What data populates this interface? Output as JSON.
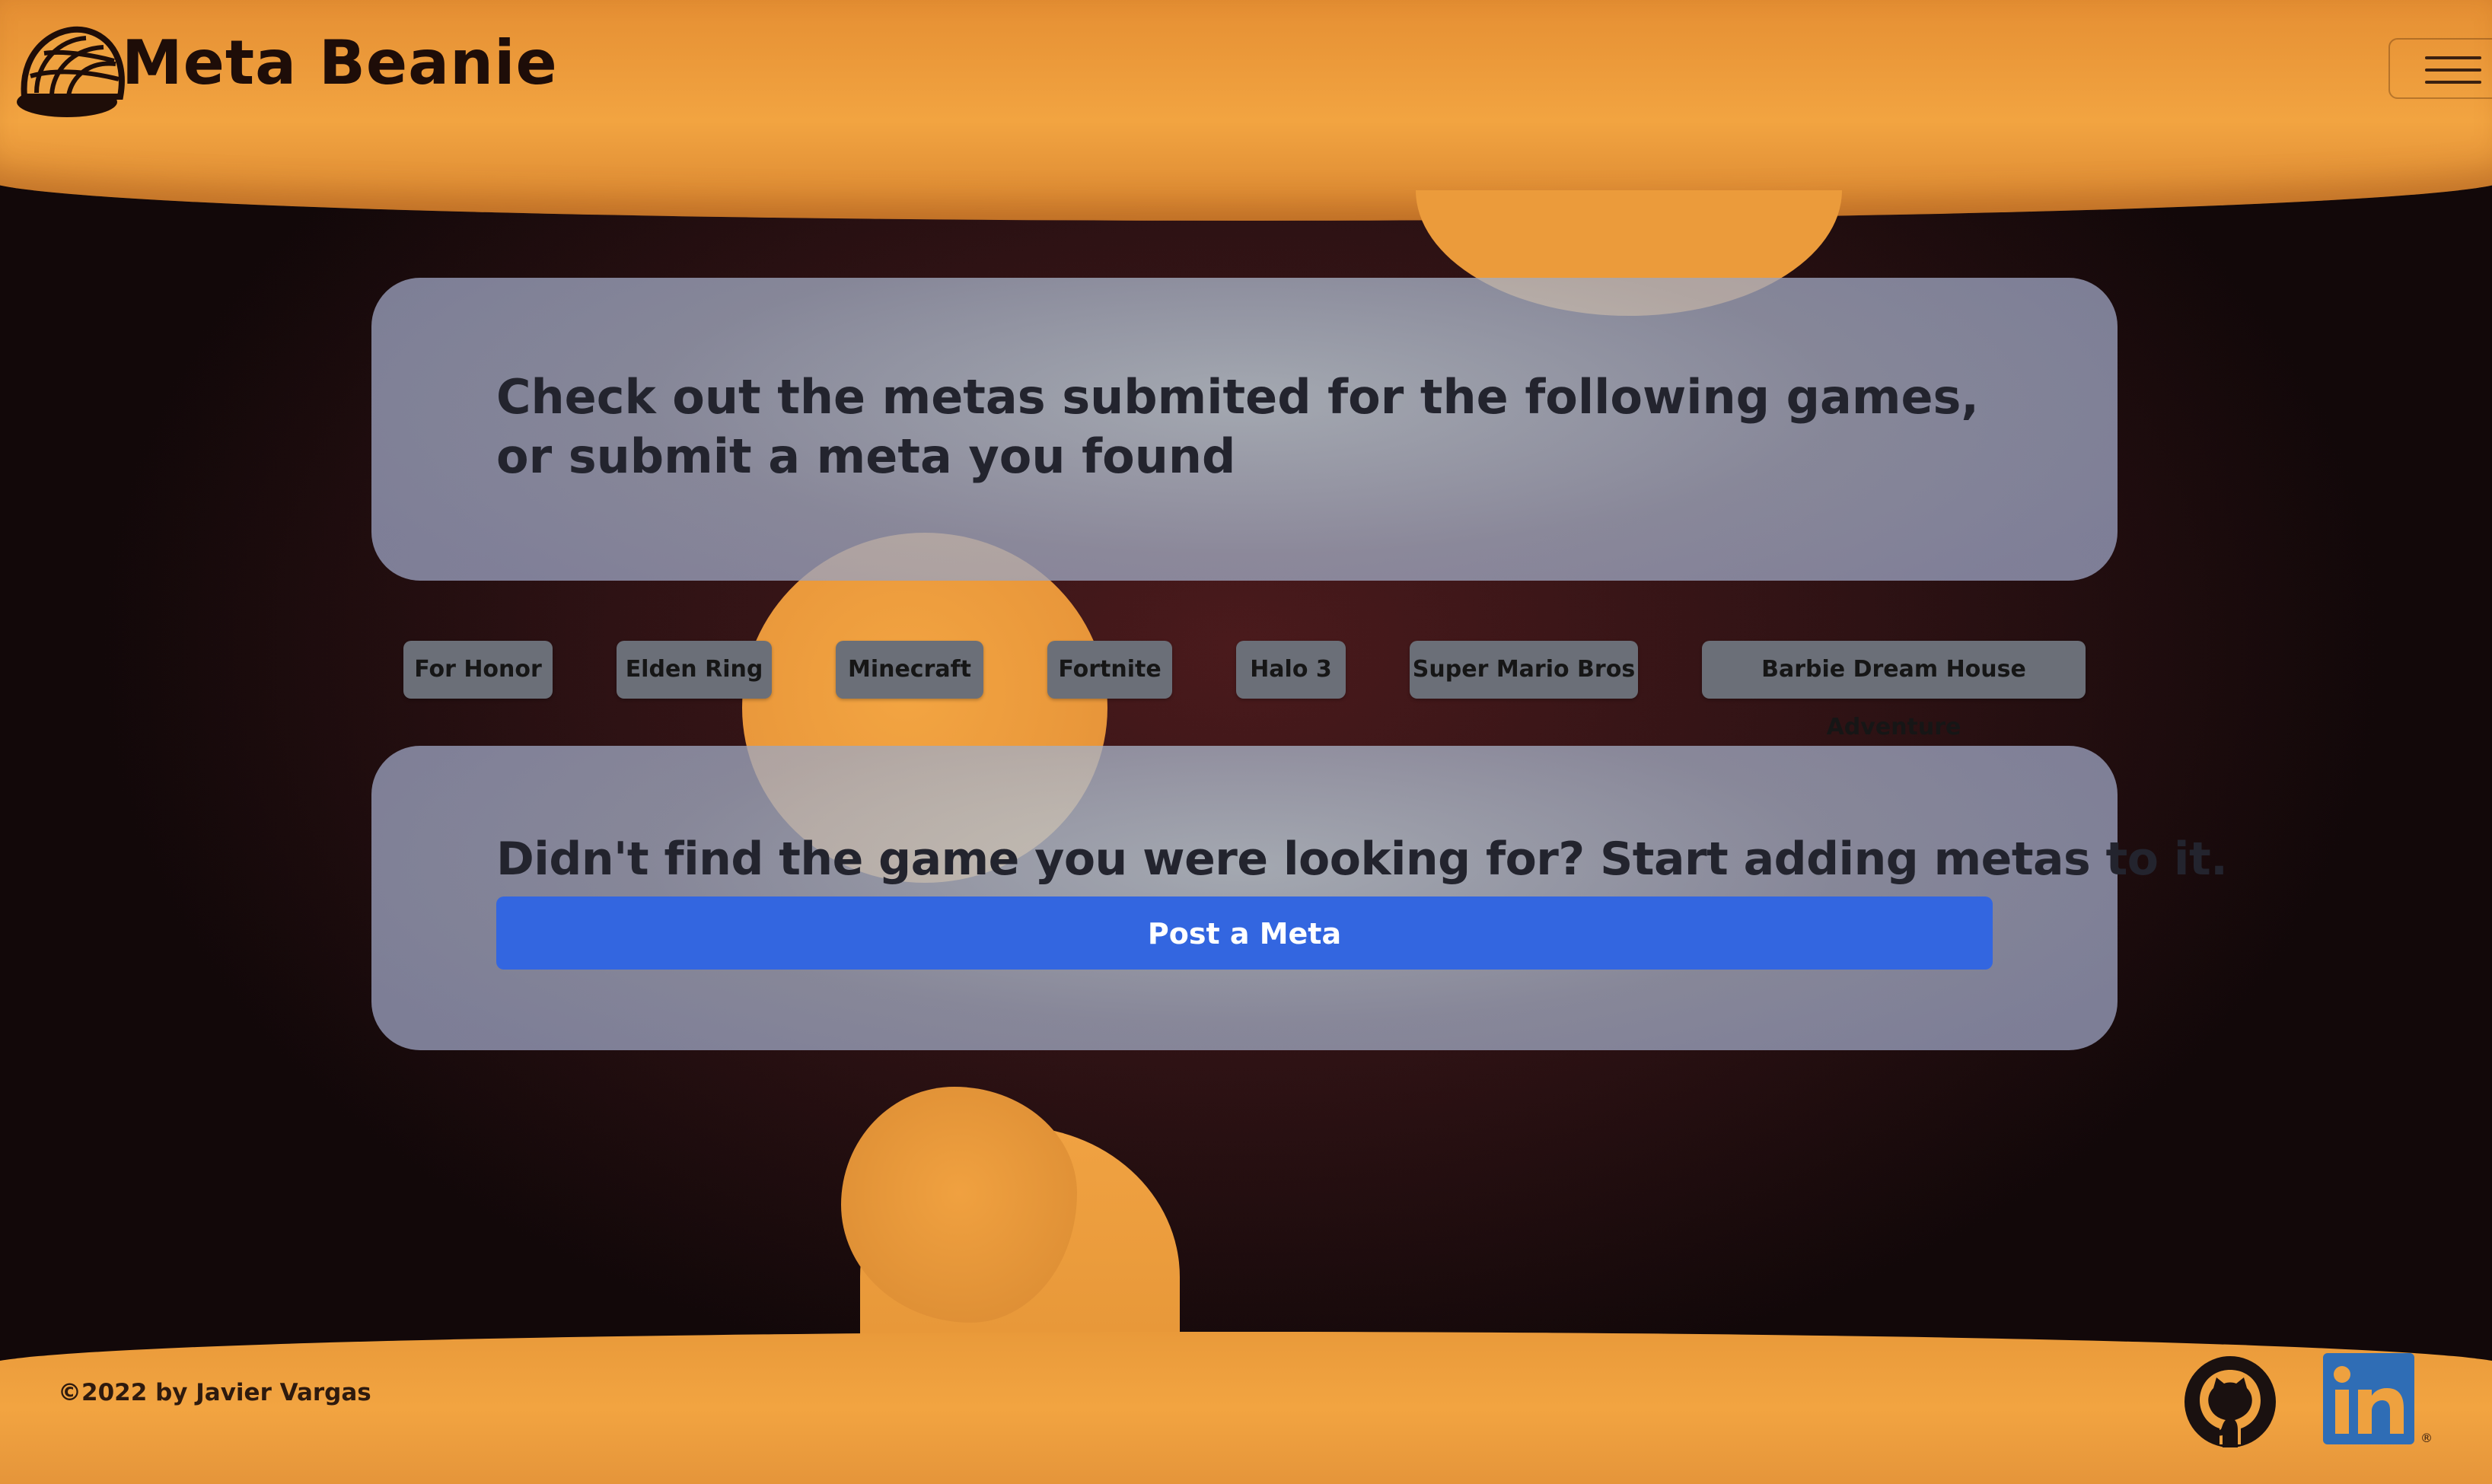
{
  "header": {
    "brand_name": "Meta Beanie",
    "logo_icon": "beanie-icon",
    "menu_icon": "hamburger-menu-icon"
  },
  "intro": {
    "text": "Check out the metas submited for the following games, or submit a meta you found"
  },
  "games": [
    {
      "label": "For Honor"
    },
    {
      "label": "Elden Ring"
    },
    {
      "label": "Minecraft"
    },
    {
      "label": "Fortnite"
    },
    {
      "label": "Halo 3"
    },
    {
      "label": "Super Mario Bros"
    },
    {
      "label": "Barbie Dream House Adventure"
    }
  ],
  "cta": {
    "text": "Didn't find the game you were looking for? Start adding metas to it.",
    "button_label": "Post a Meta"
  },
  "footer": {
    "copyright": "©2022 by Javier Vargas",
    "github_icon": "github-icon",
    "linkedin_icon": "linkedin-icon",
    "linkedin_mark": "®"
  },
  "colors": {
    "accent_orange": "#eea13f",
    "background_dark": "#2e1214",
    "primary_button": "#3366e0",
    "game_button": "#6b6f78"
  }
}
